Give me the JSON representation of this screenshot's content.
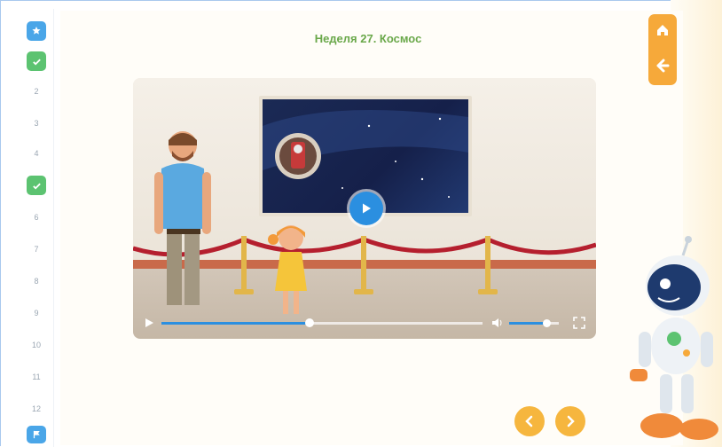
{
  "title": "Неделя 27. Космос",
  "sidebar": {
    "items": [
      {
        "label": "",
        "style": "blue",
        "icon": "star-icon"
      },
      {
        "label": "",
        "style": "green",
        "icon": "check-icon"
      },
      {
        "label": "2",
        "style": "plain"
      },
      {
        "label": "3",
        "style": "plain"
      },
      {
        "label": "4",
        "style": "plain"
      },
      {
        "label": "",
        "style": "green",
        "icon": "check-icon"
      },
      {
        "label": "6",
        "style": "plain"
      },
      {
        "label": "7",
        "style": "plain"
      },
      {
        "label": "8",
        "style": "plain"
      },
      {
        "label": "9",
        "style": "plain"
      },
      {
        "label": "10",
        "style": "plain"
      },
      {
        "label": "11",
        "style": "plain"
      },
      {
        "label": "12",
        "style": "plain"
      },
      {
        "label": "",
        "style": "blue",
        "icon": "flag-icon"
      }
    ]
  },
  "top_right": {
    "home_icon": "home-icon",
    "back_icon": "arrow-left-icon"
  },
  "video": {
    "progress": 0.46,
    "volume": 0.75,
    "play_icon": "play-icon",
    "volume_icon": "volume-icon",
    "fullscreen_icon": "fullscreen-icon"
  },
  "nav": {
    "prev_icon": "chevron-left-icon",
    "next_icon": "chevron-right-icon"
  },
  "colors": {
    "accent": "#f6a93a",
    "title": "#6aa84a",
    "blue": "#4aa6e8",
    "green": "#5cc371"
  }
}
